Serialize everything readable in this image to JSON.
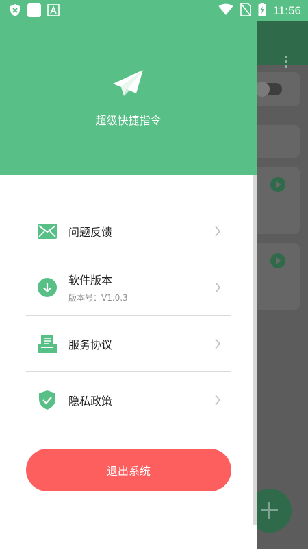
{
  "status_bar": {
    "time": "11:56"
  },
  "drawer": {
    "app_name": "超级快捷指令",
    "menu_items": [
      {
        "label": "问题反馈",
        "icon": "mail-icon"
      },
      {
        "label": "软件版本",
        "sub": "版本号：V1.0.3",
        "icon": "download-icon"
      },
      {
        "label": "服务协议",
        "icon": "agreement-icon"
      },
      {
        "label": "隐私政策",
        "icon": "shield-check-icon"
      }
    ],
    "logout_label": "退出系统"
  },
  "colors": {
    "brand_green": "#58bf87",
    "logout_red": "#fd5e5e"
  }
}
